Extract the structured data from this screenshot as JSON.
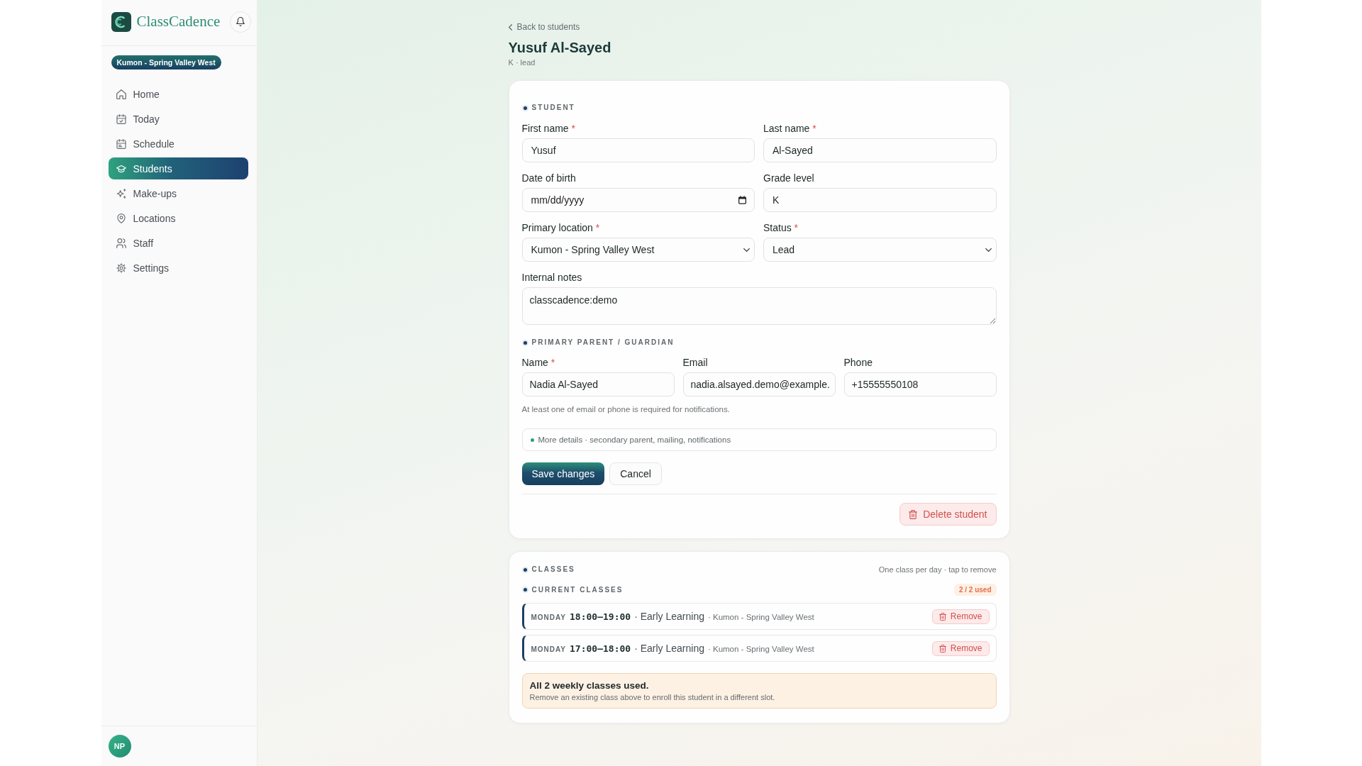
{
  "sidebar": {
    "brand": "ClassCadence",
    "location_badge": "Kumon - Spring Valley West",
    "nav": [
      {
        "label": "Home",
        "selected": false
      },
      {
        "label": "Today",
        "selected": false
      },
      {
        "label": "Schedule",
        "selected": false
      },
      {
        "label": "Students",
        "selected": true
      },
      {
        "label": "Make-ups",
        "selected": false
      },
      {
        "label": "Locations",
        "selected": false
      },
      {
        "label": "Staff",
        "selected": false
      },
      {
        "label": "Settings",
        "selected": false
      }
    ],
    "user_initials": "NP"
  },
  "back_link": "Back to students",
  "title": "Yusuf Al-Sayed",
  "subtitle": "K · lead",
  "required_mark": "*",
  "student_section": {
    "heading": "STUDENT",
    "fields": [
      {
        "label": "First name",
        "required": true,
        "kind": "text",
        "value": "Yusuf"
      },
      {
        "label": "Last name",
        "required": true,
        "kind": "text",
        "value": "Al-Sayed"
      },
      {
        "label": "Date of birth",
        "required": false,
        "kind": "date",
        "placeholder": "mm/dd/yyyy"
      },
      {
        "label": "Grade level",
        "required": false,
        "kind": "text",
        "value": "K"
      },
      {
        "label": "Primary location",
        "required": true,
        "kind": "select",
        "value": "Kumon - Spring Valley West"
      },
      {
        "label": "Status",
        "required": true,
        "kind": "select",
        "value": "Lead"
      },
      {
        "label": "Internal notes",
        "required": false,
        "kind": "textarea",
        "value": "classcadence:demo"
      }
    ]
  },
  "parent_section": {
    "heading": "PRIMARY PARENT / GUARDIAN",
    "fields": [
      {
        "label": "Name",
        "required": true,
        "kind": "text",
        "value": "Nadia Al-Sayed"
      },
      {
        "label": "Email",
        "required": false,
        "kind": "text",
        "value": "nadia.alsayed.demo@example."
      },
      {
        "label": "Phone",
        "required": false,
        "kind": "text",
        "value": "+15555550108"
      }
    ],
    "hint": "At least one of email or phone is required for notifications.",
    "more_details": "More details · secondary parent, mailing, notifications"
  },
  "actions": {
    "save": "Save changes",
    "cancel": "Cancel",
    "delete": "Delete student"
  },
  "classes": {
    "heading": "CLASSES",
    "note": "One class per day · tap to remove",
    "current_heading": "CURRENT CLASSES",
    "usage_badge": "2 / 2 used",
    "rows": [
      {
        "day": "MONDAY",
        "time": "18:00–19:00",
        "program": "· Early Learning",
        "location": "· Kumon - Spring Valley West",
        "action": "Remove"
      },
      {
        "day": "MONDAY",
        "time": "17:00–18:00",
        "program": "· Early Learning",
        "location": "· Kumon - Spring Valley West",
        "action": "Remove"
      }
    ],
    "alert": {
      "title": "All 2 weekly classes used.",
      "body": "Remove an existing class above to enroll this student in a different slot."
    }
  }
}
